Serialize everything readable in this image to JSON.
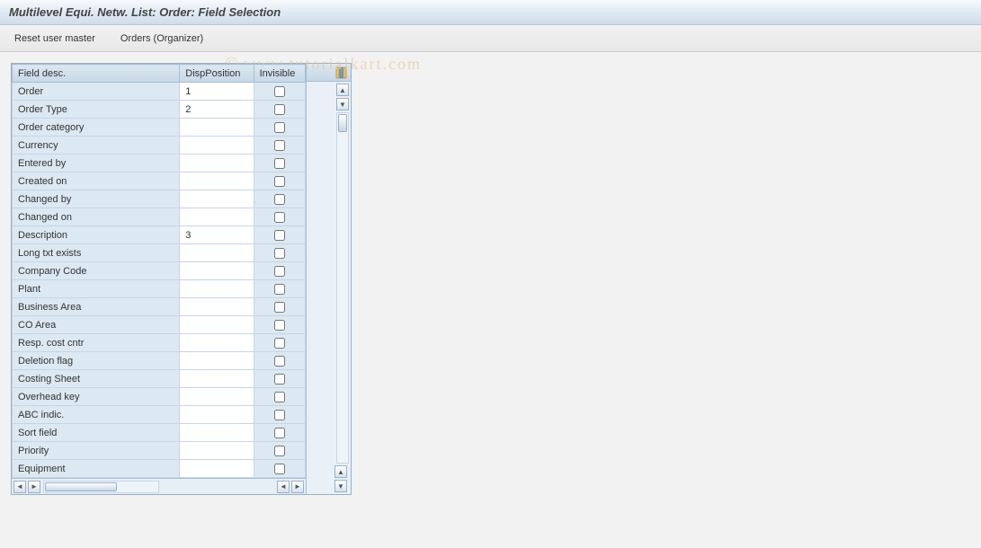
{
  "title": "Multilevel Equi. Netw. List: Order: Field Selection",
  "toolbar": {
    "reset": "Reset user master",
    "orders": "Orders (Organizer)"
  },
  "columns": {
    "field": "Field desc.",
    "position": "DispPosition",
    "invisible": "Invisible"
  },
  "rows": [
    {
      "field": "Order",
      "pos": "1",
      "inv": false
    },
    {
      "field": "Order Type",
      "pos": "2",
      "inv": false
    },
    {
      "field": "Order category",
      "pos": "",
      "inv": false
    },
    {
      "field": "Currency",
      "pos": "",
      "inv": false
    },
    {
      "field": "Entered by",
      "pos": "",
      "inv": false
    },
    {
      "field": "Created on",
      "pos": "",
      "inv": false
    },
    {
      "field": "Changed by",
      "pos": "",
      "inv": false
    },
    {
      "field": "Changed on",
      "pos": "",
      "inv": false
    },
    {
      "field": "Description",
      "pos": "3",
      "inv": false
    },
    {
      "field": "Long txt exists",
      "pos": "",
      "inv": false
    },
    {
      "field": "Company Code",
      "pos": "",
      "inv": false
    },
    {
      "field": "Plant",
      "pos": "",
      "inv": false
    },
    {
      "field": "Business Area",
      "pos": "",
      "inv": false
    },
    {
      "field": "CO Area",
      "pos": "",
      "inv": false
    },
    {
      "field": "Resp. cost cntr",
      "pos": "",
      "inv": false
    },
    {
      "field": "Deletion flag",
      "pos": "",
      "inv": false
    },
    {
      "field": "Costing Sheet",
      "pos": "",
      "inv": false
    },
    {
      "field": "Overhead key",
      "pos": "",
      "inv": false
    },
    {
      "field": "ABC indic.",
      "pos": "",
      "inv": false
    },
    {
      "field": "Sort field",
      "pos": "",
      "inv": false
    },
    {
      "field": "Priority",
      "pos": "",
      "inv": false
    },
    {
      "field": "Equipment",
      "pos": "",
      "inv": false
    }
  ],
  "watermark": "www.tutorialkart.com"
}
